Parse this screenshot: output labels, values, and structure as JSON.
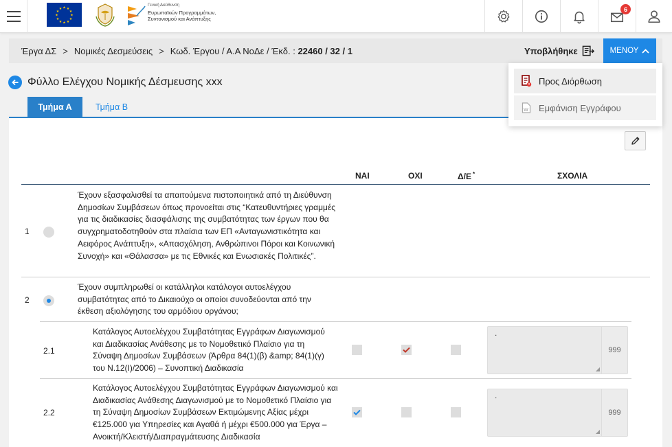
{
  "header": {
    "logo_gd_line1": "Γενική Διεύθυνση",
    "logo_gd_line2": "Ευρωπαϊκών Προγραμμάτων,",
    "logo_gd_line3": "Συντονισμού και Ανάπτυξης",
    "icons": [
      "gear-icon",
      "info-icon",
      "bell-icon",
      "mail-icon",
      "user-icon"
    ],
    "mail_badge": "6"
  },
  "breadcrumb": {
    "item1": "Έργα ΔΣ",
    "item2": "Νομικές Δεσμεύσεις",
    "item3_prefix": "Κωδ. Έργου / Α.Α ΝοΔε / Έκδ. :",
    "item3_value": "22460 / 32 / 1",
    "separator": ">",
    "status": "Υποβλήθηκε",
    "menu_label": "ΜΕΝΟΥ"
  },
  "menu": {
    "items": [
      {
        "label": "Προς Διόρθωση",
        "icon": "pdf-flag-icon"
      },
      {
        "label": "Εμφάνιση Εγγράφου",
        "icon": "word-doc-icon"
      }
    ]
  },
  "page": {
    "title": "Φύλλο Ελέγχου Νομικής Δέσμευσης xxx",
    "tabs": [
      "Τμήμα Α",
      "Τμήμα Β"
    ],
    "active_tab": "Τμήμα Α"
  },
  "table": {
    "headers": {
      "yes": "ΝΑΙ",
      "no": "ΟΧΙ",
      "na": "Δ/Ε",
      "na_mark": "*",
      "comments": "ΣΧΟΛΙΑ"
    },
    "rows": [
      {
        "num": "1",
        "text": "Έχουν εξασφαλισθεί τα απαιτούμενα πιστοποιητικά από τη Διεύθυνση Δημοσίων Συμβάσεων όπως προνοείται στις “Κατευθυντήριες γραμμές για τις διαδικασίες διασφάλισης της συμβατότητας των έργων που θα συγχρηματοδοτηθούν στα πλαίσια των ΕΠ «Ανταγωνιστικότητα και Αειφόρος Ανάπτυξη», «Απασχόληση, Ανθρώπινοι Πόροι και Κοινωνική Συνοχή» και «Θάλασσα» με τις Εθνικές και Ενωσιακές Πολιτικές”.",
        "radio_selected": false
      },
      {
        "num": "2",
        "text": "Έχουν συμπληρωθεί οι κατάλληλοι κατάλογοι αυτοελέγχου συμβατότητας από το Δικαιούχο οι οποίοι συνοδεύονται από την έκθεση αξιολόγησης του αρμόδιου οργάνου;",
        "radio_selected": true
      }
    ],
    "subrows": [
      {
        "num": "2.1",
        "text": "Κατάλογος Αυτοελέγχου Συμβατότητας Εγγράφων Διαγωνισμού και Διαδικασίας Ανάθεσης με το Νομοθετικό Πλαίσιο για τη Σύναψη Δημοσίων Συμβάσεων (Άρθρα 84(1)(β) &amp; 84(1)(γ) του Ν.12(Ι)/2006) – Συνοπτική Διαδικασία",
        "yes": false,
        "no": true,
        "na": false,
        "comment": ".",
        "counter": "999"
      },
      {
        "num": "2.2",
        "text": "Κατάλογος Αυτοελέγχου Συμβατότητας Εγγράφων Διαγωνισμού και Διαδικασίας Ανάθεσης Διαγωνισμού με το Νομοθετικό Πλαίσιο για τη Σύναψη Δημοσίων Συμβάσεων Εκτιμώμενης Αξίας μέχρι €125.000 για Υπηρεσίες και Αγαθά ή μέχρι €500.000 για Έργα – Ανοικτή/Κλειστή/Διαπραγμάτευσης Διαδικασία",
        "yes": true,
        "no": false,
        "na": false,
        "comment": ".",
        "counter": "999"
      }
    ]
  },
  "colors": {
    "accent": "#1e88e5",
    "tab_active": "#2980c9",
    "check_red": "#c0392b",
    "badge": "#e53935"
  }
}
